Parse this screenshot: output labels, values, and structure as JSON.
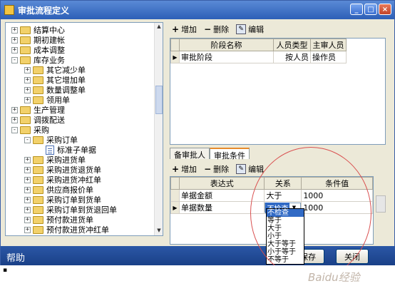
{
  "window": {
    "title": "审批流程定义"
  },
  "tree": {
    "items": [
      {
        "label": "结算中心",
        "level": 1,
        "expander": "+",
        "icon": "folder-icon"
      },
      {
        "label": "期初建帐",
        "level": 1,
        "expander": "+",
        "icon": "folder-icon"
      },
      {
        "label": "成本调整",
        "level": 1,
        "expander": "+",
        "icon": "folder-icon"
      },
      {
        "label": "库存业务",
        "level": 1,
        "expander": "-",
        "icon": "folder-icon"
      },
      {
        "label": "其它减少单",
        "level": 2,
        "expander": "+",
        "icon": "folder-icon"
      },
      {
        "label": "其它增加单",
        "level": 2,
        "expander": "+",
        "icon": "folder-icon"
      },
      {
        "label": "数量调整单",
        "level": 2,
        "expander": "+",
        "icon": "folder-icon"
      },
      {
        "label": "领用单",
        "level": 2,
        "expander": "+",
        "icon": "folder-icon"
      },
      {
        "label": "生产管理",
        "level": 1,
        "expander": "+",
        "icon": "folder-icon"
      },
      {
        "label": "调拨配送",
        "level": 1,
        "expander": "+",
        "icon": "folder-icon"
      },
      {
        "label": "采购",
        "level": 1,
        "expander": "-",
        "icon": "folder-icon"
      },
      {
        "label": "采购订单",
        "level": 2,
        "expander": "-",
        "icon": "folder-icon"
      },
      {
        "label": "标准子单据",
        "level": 3,
        "expander": "",
        "icon": "document-icon"
      },
      {
        "label": "采购进货单",
        "level": 2,
        "expander": "+",
        "icon": "folder-icon"
      },
      {
        "label": "采购进货退货单",
        "level": 2,
        "expander": "+",
        "icon": "folder-icon"
      },
      {
        "label": "采购进货冲红单",
        "level": 2,
        "expander": "+",
        "icon": "folder-icon"
      },
      {
        "label": "供应商报价单",
        "level": 2,
        "expander": "+",
        "icon": "folder-icon"
      },
      {
        "label": "采购订单到货单",
        "level": 2,
        "expander": "+",
        "icon": "folder-icon"
      },
      {
        "label": "采购订单到货退回单",
        "level": 2,
        "expander": "+",
        "icon": "folder-icon"
      },
      {
        "label": "预付款进货单",
        "level": 2,
        "expander": "+",
        "icon": "folder-icon"
      },
      {
        "label": "预付款进货冲红单",
        "level": 2,
        "expander": "+",
        "icon": "folder-icon"
      }
    ]
  },
  "top_toolbar": {
    "add": "增加",
    "delete": "删除",
    "edit": "编辑"
  },
  "stage_grid": {
    "columns": [
      "阶段名称",
      "人员类型",
      "主审人员"
    ],
    "rows": [
      {
        "name": "审批阶段",
        "type": "按人员",
        "reviewer": "操作员"
      }
    ]
  },
  "tabs": [
    {
      "label": "备审批人"
    },
    {
      "label": "审批条件"
    }
  ],
  "bottom_toolbar": {
    "add": "增加",
    "delete": "删除",
    "edit": "编辑"
  },
  "condition_grid": {
    "columns": [
      "表达式",
      "关系",
      "条件值"
    ],
    "rows": [
      {
        "expr": "单据金额",
        "rel": "大于",
        "value": "1000"
      },
      {
        "expr": "单据数量",
        "rel": "不检查",
        "value": "1000"
      }
    ]
  },
  "relation_dropdown": {
    "options": [
      "不检查",
      "等于",
      "大于",
      "小于",
      "大于等于",
      "小于等于",
      "不等于"
    ],
    "selected": "不检查"
  },
  "footer": {
    "help": "帮助",
    "save": "保存",
    "close": "关闭"
  },
  "watermark": "Baidu经验",
  "colors": {
    "title_bar": "#2d5fb7",
    "footer_bar": "#193f86",
    "selection": "#316ac5",
    "annotation_circle": "#d94f4f"
  }
}
